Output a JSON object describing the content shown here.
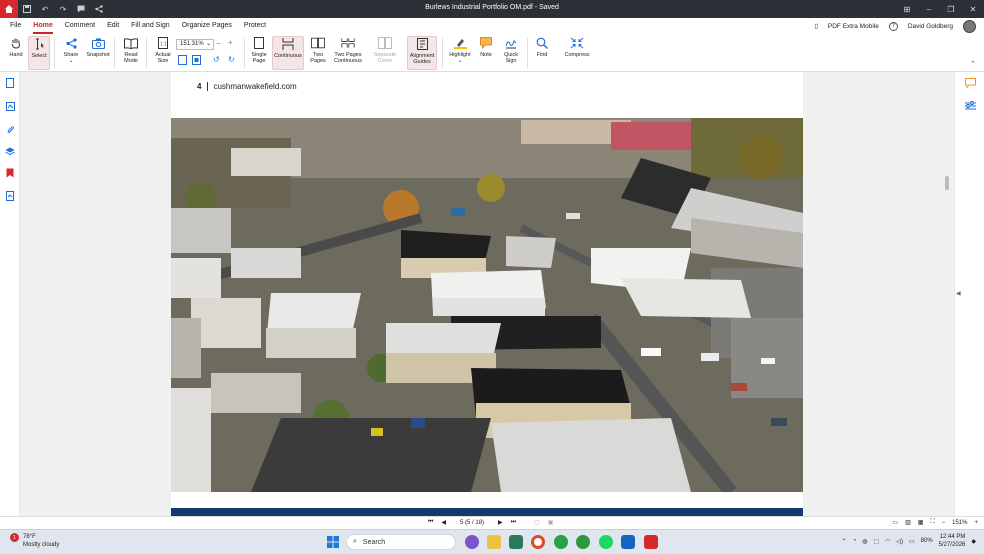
{
  "titlebar": {
    "title": "Burlews Industrial Portfolio OM.pdf - Saved"
  },
  "menu": {
    "items": [
      "File",
      "Home",
      "Comment",
      "Edit",
      "Fill and Sign",
      "Organize Pages",
      "Protect"
    ],
    "active": "Home",
    "pdf_extra_mobile": "PDF Extra Mobile",
    "user_name": "David Goldberg"
  },
  "ribbon": {
    "hand": "Hand",
    "select": "Select",
    "share": "Share",
    "snapshot": "Snapshot",
    "read_mode_1": "Read",
    "read_mode_2": "Mode",
    "actual_size_1": "Actual",
    "actual_size_2": "Size",
    "zoom": "151.31%",
    "single_page_1": "Single",
    "single_page_2": "Page",
    "continuous": "Continuous",
    "two_pages_1": "Two",
    "two_pages_2": "Pages",
    "two_pages_cont_1": "Two Pages",
    "two_pages_cont_2": "Continuous",
    "separate_cover_1": "Separate",
    "separate_cover_2": "Cover",
    "alignment_guides_1": "Alignment",
    "alignment_guides_2": "Guides",
    "highlight": "Highlight",
    "note": "Note",
    "quick_sign_1": "Quick",
    "quick_sign_2": "Sign",
    "find": "Find",
    "compress": "Compress"
  },
  "page": {
    "number": "4",
    "url": "cushmanwakefield.com"
  },
  "status": {
    "page_indicator": "5 (5 / 18)",
    "zoom": "151%"
  },
  "taskbar": {
    "weather_temp": "78°F",
    "weather_desc": "Mostly cloudy",
    "weather_badge": "1",
    "search_label": "Search",
    "battery": "80%",
    "time": "12:44 PM",
    "date": "5/27/2026"
  },
  "colors": {
    "accent": "#c62828",
    "titlebar": "#2b3137",
    "band": "#123a6b"
  }
}
